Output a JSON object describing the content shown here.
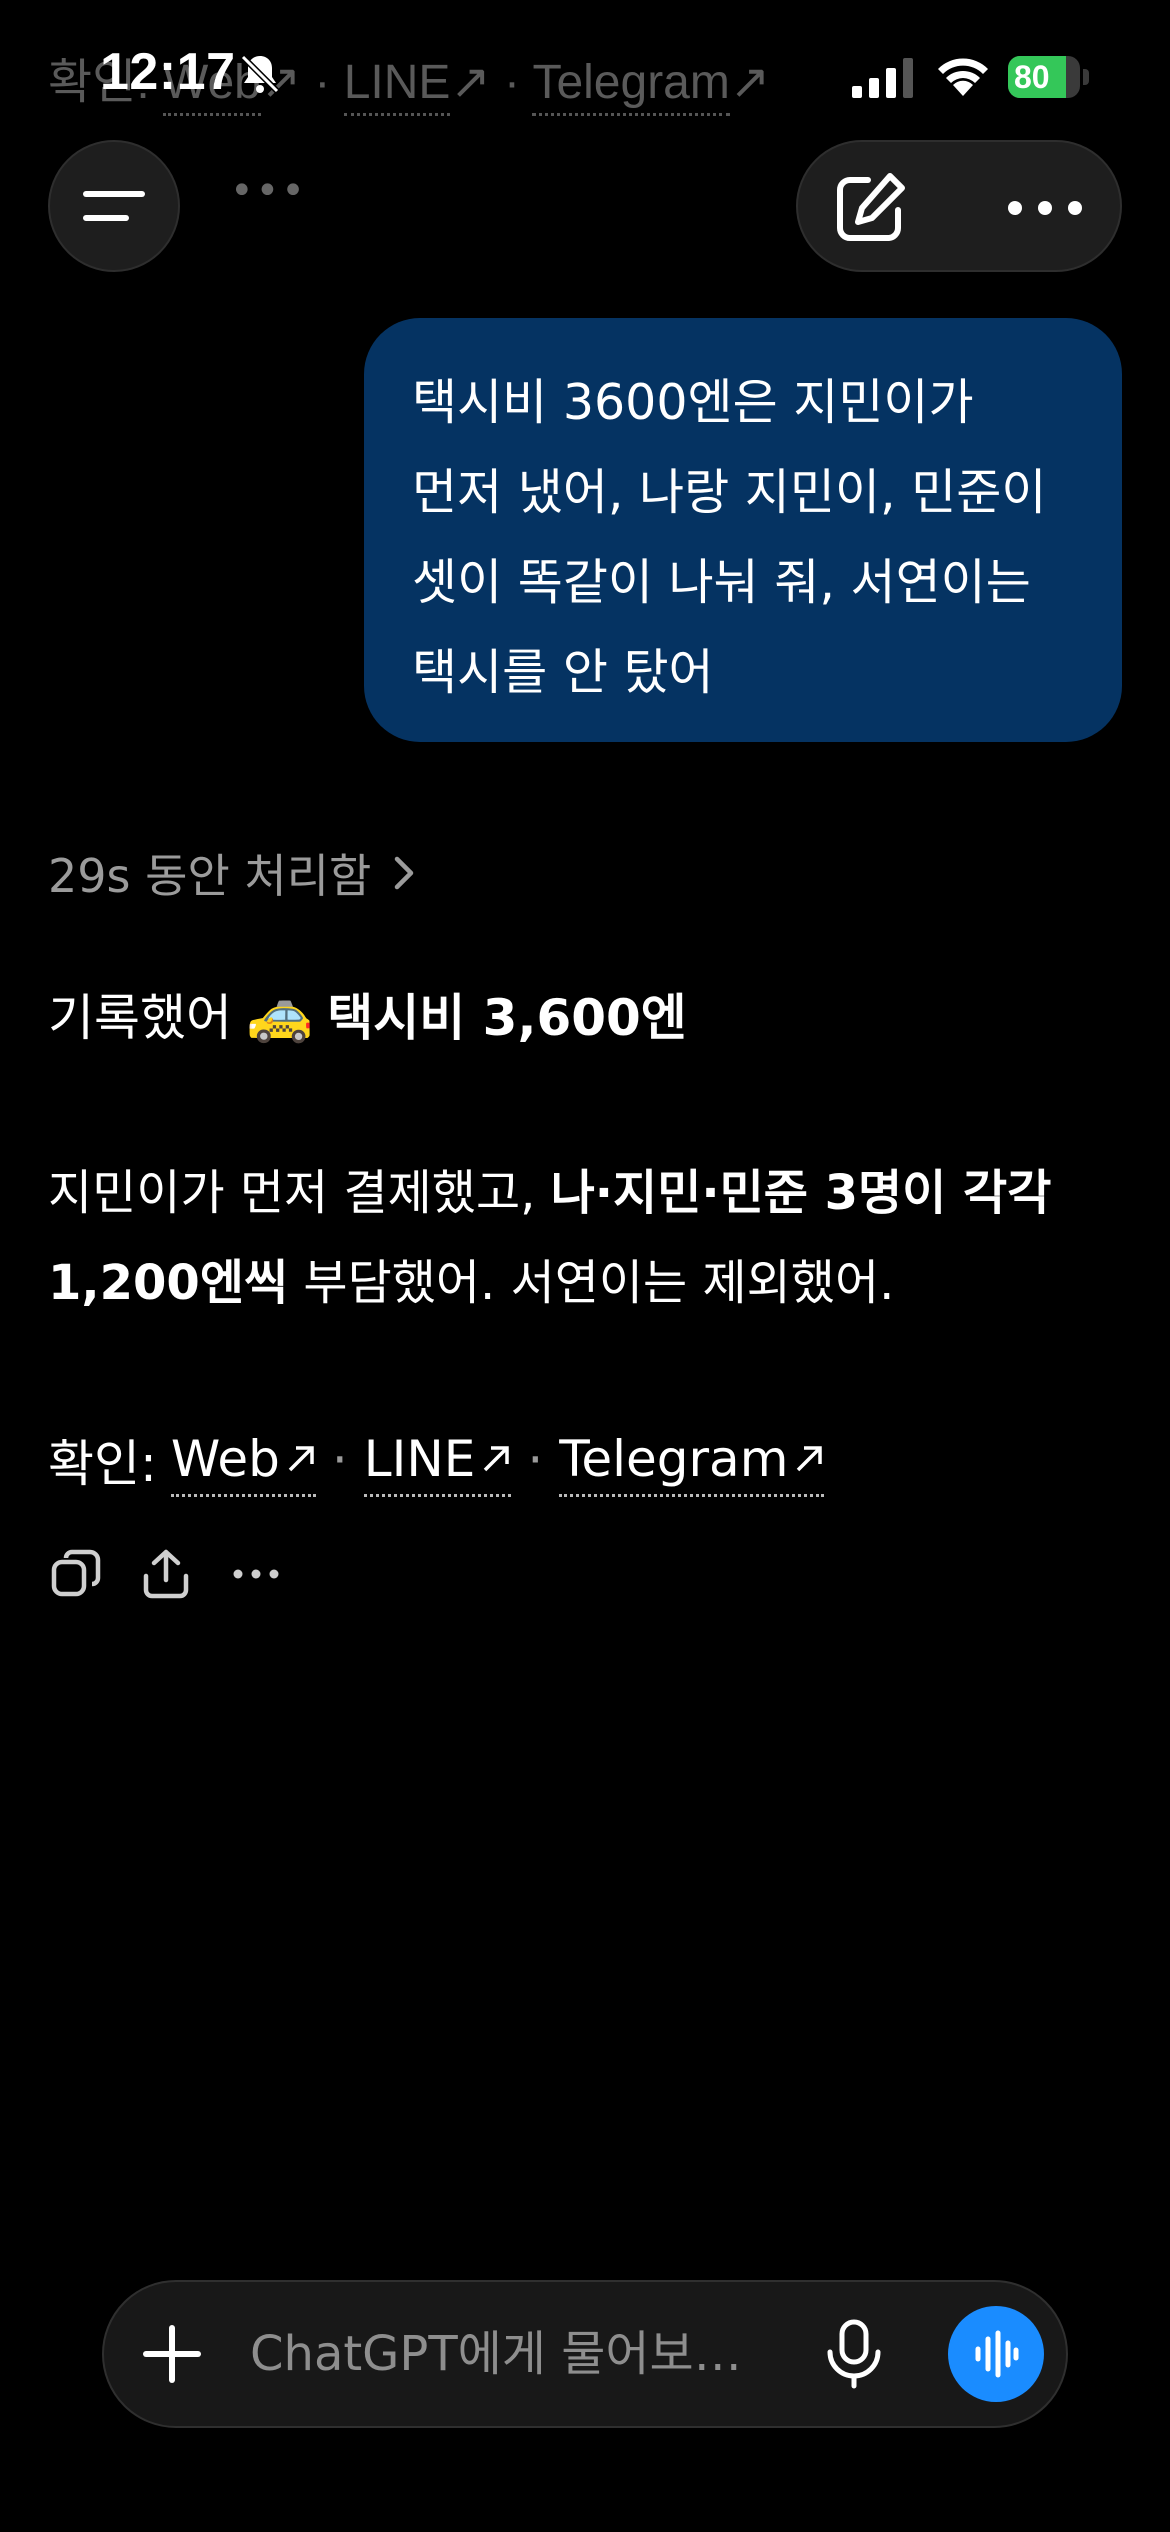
{
  "status_bar": {
    "time": "12:17",
    "battery_text": "80",
    "battery_level": 0.8,
    "battery_color": "#34c759"
  },
  "ghost_row": {
    "prefix": "확인:",
    "links": [
      "Web",
      "LINE",
      "Telegram"
    ]
  },
  "conversation": {
    "user_message": "택시비 3600엔은 지민이가 먼저 냈어, 나랑 지민이, 민준이 셋이 똑같이 나눠 줘, 서연이는 택시를 안 탔어",
    "thinking_label": "29s 동안 처리함",
    "reply": {
      "line1_plain": "기록했어",
      "line1_emoji": "🚕",
      "line1_bold": "택시비 3,600엔",
      "line2_plain_a": "지민이가 먼저 결제했고, ",
      "line2_bold": "나·지민·민준 3명이 각각 1,200엔씩",
      "line2_plain_b": " 부담했어. 서연이는 제외했어.",
      "confirm_prefix": "확인:",
      "links": [
        "Web",
        "LINE",
        "Telegram"
      ],
      "link_separator": "·"
    }
  },
  "composer": {
    "placeholder": "ChatGPT에게 물어보…"
  },
  "colors": {
    "background": "#000000",
    "user_bubble": "#053362",
    "voice_button": "#1a8cff",
    "muted_text": "#9b9b9b"
  },
  "icons": {
    "menu": "menu-icon",
    "edit": "edit-icon",
    "more": "more-icon",
    "copy": "copy-icon",
    "share": "share-icon",
    "plus": "plus-icon",
    "mic": "mic-icon",
    "voice": "voice-waveform-icon"
  }
}
